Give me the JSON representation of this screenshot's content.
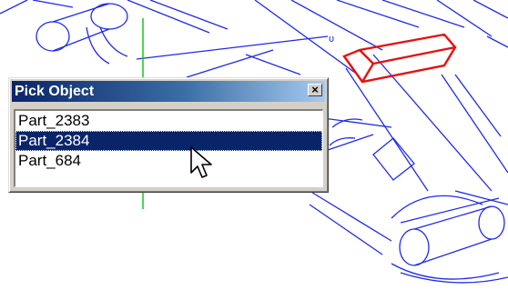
{
  "dialog": {
    "title": "Pick Object",
    "close_glyph": "×",
    "items": [
      "Part_2383",
      "Part_2384",
      "Part_684"
    ],
    "selected_index": 1
  },
  "colors": {
    "wireframe": "#1f2be6",
    "highlight": "#e61010",
    "axis": "#19c519",
    "title_bar_start": "#0a246a",
    "title_bar_end": "#a6caf0",
    "selection": "#0a246a"
  },
  "cursor": {
    "icon": "arrow-pointer-icon"
  }
}
